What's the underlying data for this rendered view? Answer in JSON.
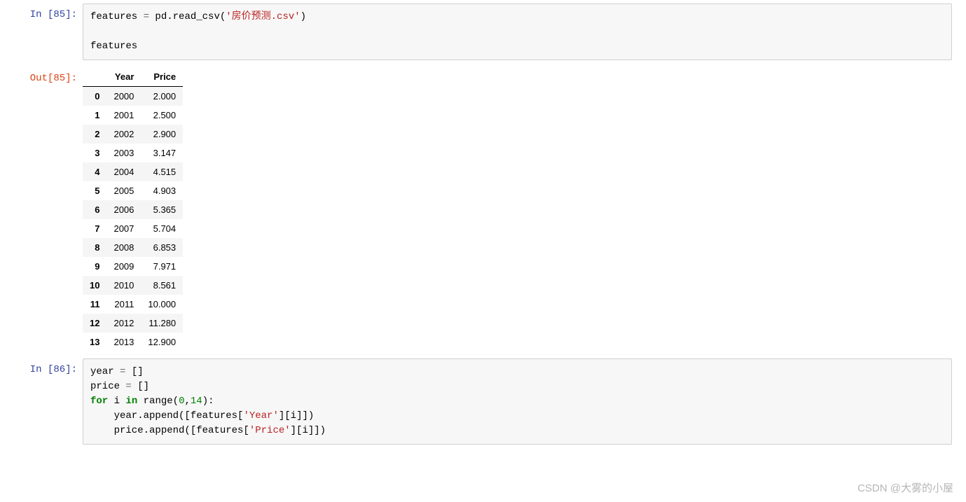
{
  "cells": {
    "in85": {
      "prompt": "In  [85]:",
      "code": {
        "lhs": "features ",
        "op1": "=",
        "call1": " pd.read_csv(",
        "str1": "'房价预测.csv'",
        "call1_close": ")",
        "blank": "",
        "line2": "features"
      }
    },
    "out85": {
      "prompt": "Out[85]:"
    },
    "in86": {
      "prompt": "In  [86]:",
      "code": {
        "l1a": "year ",
        "l1op": "=",
        "l1b": " []",
        "l2a": "price ",
        "l2op": "=",
        "l2b": " []",
        "l3a": "for ",
        "l3b": "i ",
        "l3c": "in ",
        "l3d": "range(",
        "l3n1": "0",
        "l3comma": ",",
        "l3n2": "14",
        "l3e": "):",
        "l4a": "    year.append([features[",
        "l4s": "'Year'",
        "l4b": "][i]])",
        "l5a": "    price.append([features[",
        "l5s": "'Price'",
        "l5b": "][i]])"
      }
    }
  },
  "dataframe": {
    "columns": [
      "Year",
      "Price"
    ],
    "index": [
      "0",
      "1",
      "2",
      "3",
      "4",
      "5",
      "6",
      "7",
      "8",
      "9",
      "10",
      "11",
      "12",
      "13"
    ],
    "rows": [
      [
        "2000",
        "2.000"
      ],
      [
        "2001",
        "2.500"
      ],
      [
        "2002",
        "2.900"
      ],
      [
        "2003",
        "3.147"
      ],
      [
        "2004",
        "4.515"
      ],
      [
        "2005",
        "4.903"
      ],
      [
        "2006",
        "5.365"
      ],
      [
        "2007",
        "5.704"
      ],
      [
        "2008",
        "6.853"
      ],
      [
        "2009",
        "7.971"
      ],
      [
        "2010",
        "8.561"
      ],
      [
        "2011",
        "10.000"
      ],
      [
        "2012",
        "11.280"
      ],
      [
        "2013",
        "12.900"
      ]
    ]
  },
  "chart_data": {
    "type": "table",
    "title": "",
    "columns": [
      "Year",
      "Price"
    ],
    "index": [
      0,
      1,
      2,
      3,
      4,
      5,
      6,
      7,
      8,
      9,
      10,
      11,
      12,
      13
    ],
    "series": [
      {
        "name": "Year",
        "values": [
          2000,
          2001,
          2002,
          2003,
          2004,
          2005,
          2006,
          2007,
          2008,
          2009,
          2010,
          2011,
          2012,
          2013
        ]
      },
      {
        "name": "Price",
        "values": [
          2.0,
          2.5,
          2.9,
          3.147,
          4.515,
          4.903,
          5.365,
          5.704,
          6.853,
          7.971,
          8.561,
          10.0,
          11.28,
          12.9
        ]
      }
    ]
  },
  "watermark": "CSDN @大雾的小屋"
}
